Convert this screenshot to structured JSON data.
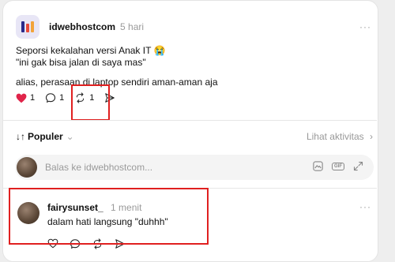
{
  "post": {
    "username": "idwebhostcom",
    "time": "5 hari",
    "more": "···",
    "line1": "Seporsi kekalahan versi Anak IT 😭",
    "line2": "\"ini gak bisa jalan di saya mas\"",
    "line3": "alias, perasaan di laptop sendiri aman-aman aja",
    "likes": "1",
    "comments": "1",
    "reposts": "1"
  },
  "sort": {
    "label": "Populer",
    "activity": "Lihat aktivitas"
  },
  "reply": {
    "placeholder": "Balas ke idwebhostcom...",
    "gif": "GIF"
  },
  "comment": {
    "username": "fairysunset_",
    "time": "1 menit",
    "text": "dalam hati langsung \"duhhh\"",
    "more": "···"
  },
  "colors": {
    "heart": "#e0244a",
    "highlight": "#e02020"
  }
}
